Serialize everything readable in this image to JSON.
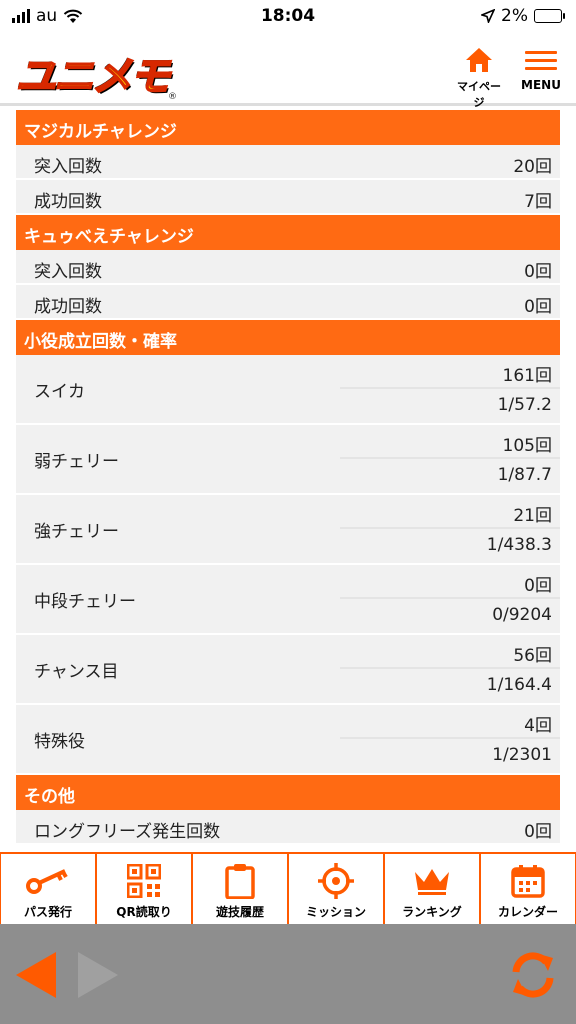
{
  "status": {
    "carrier": "au",
    "time": "18:04",
    "battery": "2%"
  },
  "header": {
    "logo_text": "ユニメモ",
    "logo_mark": "®",
    "mypage_label": "マイページ",
    "menu_label": "MENU"
  },
  "sections": {
    "magical": {
      "title": "マジカルチャレンジ",
      "rows": [
        {
          "label": "突入回数",
          "value": "20回"
        },
        {
          "label": "成功回数",
          "value": "7回"
        }
      ]
    },
    "kyubey": {
      "title": "キュゥべえチャレンジ",
      "rows": [
        {
          "label": "突入回数",
          "value": "0回"
        },
        {
          "label": "成功回数",
          "value": "0回"
        }
      ]
    },
    "koyaku": {
      "title": "小役成立回数・確率",
      "rows": [
        {
          "label": "スイカ",
          "count": "161回",
          "prob": "1/57.2"
        },
        {
          "label": "弱チェリー",
          "count": "105回",
          "prob": "1/87.7"
        },
        {
          "label": "強チェリー",
          "count": "21回",
          "prob": "1/438.3"
        },
        {
          "label": "中段チェリー",
          "count": "0回",
          "prob": "0/9204"
        },
        {
          "label": "チャンス目",
          "count": "56回",
          "prob": "1/164.4"
        },
        {
          "label": "特殊役",
          "count": "4回",
          "prob": "1/2301"
        }
      ]
    },
    "other": {
      "title": "その他",
      "rows": [
        {
          "label": "ロングフリーズ発生回数",
          "value": "0回"
        }
      ]
    }
  },
  "bottom_nav": [
    {
      "label": "パス発行",
      "icon": "key-icon"
    },
    {
      "label": "QR読取り",
      "icon": "qr-icon"
    },
    {
      "label": "遊技履歴",
      "icon": "clipboard-icon"
    },
    {
      "label": "ミッション",
      "icon": "target-icon"
    },
    {
      "label": "ランキング",
      "icon": "crown-icon"
    },
    {
      "label": "カレンダー",
      "icon": "calendar-icon"
    }
  ],
  "colors": {
    "accent": "#ff6a13",
    "nav_accent": "#ff5a00",
    "toolbar": "#8e8e8e"
  }
}
